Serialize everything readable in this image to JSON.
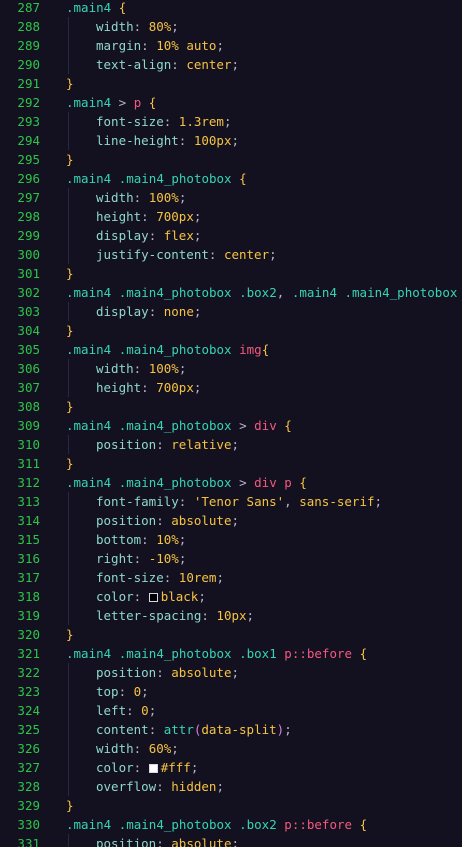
{
  "editor": {
    "colors": {
      "background": "#13111f",
      "line_number": "#2ec44a",
      "selector": "#36d3b4",
      "tag": "#f4587e",
      "brace": "#f6c343",
      "property": "#8fd8cc",
      "value": "#f6c343"
    },
    "lines": [
      {
        "n": "287",
        "indent": 0,
        "tokens": [
          {
            "t": ".main4",
            "c": "sel"
          },
          {
            "t": " ",
            "c": "plain"
          },
          {
            "t": "{",
            "c": "brace"
          }
        ]
      },
      {
        "n": "288",
        "indent": 1,
        "tokens": [
          {
            "t": "width",
            "c": "prop"
          },
          {
            "t": ": ",
            "c": "punc"
          },
          {
            "t": "80%",
            "c": "val"
          },
          {
            "t": ";",
            "c": "punc"
          }
        ]
      },
      {
        "n": "289",
        "indent": 1,
        "tokens": [
          {
            "t": "margin",
            "c": "prop"
          },
          {
            "t": ": ",
            "c": "punc"
          },
          {
            "t": "10%",
            "c": "val"
          },
          {
            "t": " ",
            "c": "plain"
          },
          {
            "t": "auto",
            "c": "val"
          },
          {
            "t": ";",
            "c": "punc"
          }
        ]
      },
      {
        "n": "290",
        "indent": 1,
        "tokens": [
          {
            "t": "text-align",
            "c": "prop"
          },
          {
            "t": ": ",
            "c": "punc"
          },
          {
            "t": "center",
            "c": "val"
          },
          {
            "t": ";",
            "c": "punc"
          }
        ]
      },
      {
        "n": "291",
        "indent": 0,
        "tokens": [
          {
            "t": "}",
            "c": "brace"
          }
        ]
      },
      {
        "n": "292",
        "indent": 0,
        "tokens": [
          {
            "t": ".main4",
            "c": "sel"
          },
          {
            "t": " > ",
            "c": "punc"
          },
          {
            "t": "p",
            "c": "tag"
          },
          {
            "t": " ",
            "c": "plain"
          },
          {
            "t": "{",
            "c": "brace"
          }
        ]
      },
      {
        "n": "293",
        "indent": 1,
        "tokens": [
          {
            "t": "font-size",
            "c": "prop"
          },
          {
            "t": ": ",
            "c": "punc"
          },
          {
            "t": "1.3rem",
            "c": "val"
          },
          {
            "t": ";",
            "c": "punc"
          }
        ]
      },
      {
        "n": "294",
        "indent": 1,
        "tokens": [
          {
            "t": "line-height",
            "c": "prop"
          },
          {
            "t": ": ",
            "c": "punc"
          },
          {
            "t": "100px",
            "c": "val"
          },
          {
            "t": ";",
            "c": "punc"
          }
        ]
      },
      {
        "n": "295",
        "indent": 0,
        "tokens": [
          {
            "t": "}",
            "c": "brace"
          }
        ]
      },
      {
        "n": "296",
        "indent": 0,
        "tokens": [
          {
            "t": ".main4",
            "c": "sel"
          },
          {
            "t": " ",
            "c": "plain"
          },
          {
            "t": ".main4_photobox",
            "c": "sel"
          },
          {
            "t": " ",
            "c": "plain"
          },
          {
            "t": "{",
            "c": "brace"
          }
        ]
      },
      {
        "n": "297",
        "indent": 1,
        "tokens": [
          {
            "t": "width",
            "c": "prop"
          },
          {
            "t": ": ",
            "c": "punc"
          },
          {
            "t": "100%",
            "c": "val"
          },
          {
            "t": ";",
            "c": "punc"
          }
        ]
      },
      {
        "n": "298",
        "indent": 1,
        "tokens": [
          {
            "t": "height",
            "c": "prop"
          },
          {
            "t": ": ",
            "c": "punc"
          },
          {
            "t": "700px",
            "c": "val"
          },
          {
            "t": ";",
            "c": "punc"
          }
        ]
      },
      {
        "n": "299",
        "indent": 1,
        "tokens": [
          {
            "t": "display",
            "c": "prop"
          },
          {
            "t": ": ",
            "c": "punc"
          },
          {
            "t": "flex",
            "c": "val"
          },
          {
            "t": ";",
            "c": "punc"
          }
        ]
      },
      {
        "n": "300",
        "indent": 1,
        "tokens": [
          {
            "t": "justify-content",
            "c": "prop"
          },
          {
            "t": ": ",
            "c": "punc"
          },
          {
            "t": "center",
            "c": "val"
          },
          {
            "t": ";",
            "c": "punc"
          }
        ]
      },
      {
        "n": "301",
        "indent": 0,
        "tokens": [
          {
            "t": "}",
            "c": "brace"
          }
        ]
      },
      {
        "n": "302",
        "indent": 0,
        "tokens": [
          {
            "t": ".main4",
            "c": "sel"
          },
          {
            "t": " ",
            "c": "plain"
          },
          {
            "t": ".main4_photobox",
            "c": "sel"
          },
          {
            "t": " ",
            "c": "plain"
          },
          {
            "t": ".box2",
            "c": "sel"
          },
          {
            "t": ", ",
            "c": "punc"
          },
          {
            "t": ".main4",
            "c": "sel"
          },
          {
            "t": " ",
            "c": "plain"
          },
          {
            "t": ".main4_photobox",
            "c": "sel"
          }
        ]
      },
      {
        "n": "303",
        "indent": 1,
        "tokens": [
          {
            "t": "display",
            "c": "prop"
          },
          {
            "t": ": ",
            "c": "punc"
          },
          {
            "t": "none",
            "c": "val"
          },
          {
            "t": ";",
            "c": "punc"
          }
        ]
      },
      {
        "n": "304",
        "indent": 0,
        "tokens": [
          {
            "t": "}",
            "c": "brace"
          }
        ]
      },
      {
        "n": "305",
        "indent": 0,
        "tokens": [
          {
            "t": ".main4",
            "c": "sel"
          },
          {
            "t": " ",
            "c": "plain"
          },
          {
            "t": ".main4_photobox",
            "c": "sel"
          },
          {
            "t": " ",
            "c": "plain"
          },
          {
            "t": "img",
            "c": "tag"
          },
          {
            "t": "{",
            "c": "brace"
          }
        ]
      },
      {
        "n": "306",
        "indent": 1,
        "tokens": [
          {
            "t": "width",
            "c": "prop"
          },
          {
            "t": ": ",
            "c": "punc"
          },
          {
            "t": "100%",
            "c": "val"
          },
          {
            "t": ";",
            "c": "punc"
          }
        ]
      },
      {
        "n": "307",
        "indent": 1,
        "tokens": [
          {
            "t": "height",
            "c": "prop"
          },
          {
            "t": ": ",
            "c": "punc"
          },
          {
            "t": "700px",
            "c": "val"
          },
          {
            "t": ";",
            "c": "punc"
          }
        ]
      },
      {
        "n": "308",
        "indent": 0,
        "tokens": [
          {
            "t": "}",
            "c": "brace"
          }
        ]
      },
      {
        "n": "309",
        "indent": 0,
        "tokens": [
          {
            "t": ".main4",
            "c": "sel"
          },
          {
            "t": " ",
            "c": "plain"
          },
          {
            "t": ".main4_photobox",
            "c": "sel"
          },
          {
            "t": " > ",
            "c": "punc"
          },
          {
            "t": "div",
            "c": "tag"
          },
          {
            "t": " ",
            "c": "plain"
          },
          {
            "t": "{",
            "c": "brace"
          }
        ]
      },
      {
        "n": "310",
        "indent": 1,
        "tokens": [
          {
            "t": "position",
            "c": "prop"
          },
          {
            "t": ": ",
            "c": "punc"
          },
          {
            "t": "relative",
            "c": "val"
          },
          {
            "t": ";",
            "c": "punc"
          }
        ]
      },
      {
        "n": "311",
        "indent": 0,
        "tokens": [
          {
            "t": "}",
            "c": "brace"
          }
        ]
      },
      {
        "n": "312",
        "indent": 0,
        "tokens": [
          {
            "t": ".main4",
            "c": "sel"
          },
          {
            "t": " ",
            "c": "plain"
          },
          {
            "t": ".main4_photobox",
            "c": "sel"
          },
          {
            "t": " > ",
            "c": "punc"
          },
          {
            "t": "div",
            "c": "tag"
          },
          {
            "t": " ",
            "c": "plain"
          },
          {
            "t": "p",
            "c": "tag"
          },
          {
            "t": " ",
            "c": "plain"
          },
          {
            "t": "{",
            "c": "brace"
          }
        ]
      },
      {
        "n": "313",
        "indent": 1,
        "tokens": [
          {
            "t": "font-family",
            "c": "prop"
          },
          {
            "t": ": ",
            "c": "punc"
          },
          {
            "t": "'Tenor Sans'",
            "c": "str"
          },
          {
            "t": ", ",
            "c": "punc"
          },
          {
            "t": "sans-serif",
            "c": "val"
          },
          {
            "t": ";",
            "c": "punc"
          }
        ]
      },
      {
        "n": "314",
        "indent": 1,
        "tokens": [
          {
            "t": "position",
            "c": "prop"
          },
          {
            "t": ": ",
            "c": "punc"
          },
          {
            "t": "absolute",
            "c": "val"
          },
          {
            "t": ";",
            "c": "punc"
          }
        ]
      },
      {
        "n": "315",
        "indent": 1,
        "tokens": [
          {
            "t": "bottom",
            "c": "prop"
          },
          {
            "t": ": ",
            "c": "punc"
          },
          {
            "t": "10%",
            "c": "val"
          },
          {
            "t": ";",
            "c": "punc"
          }
        ]
      },
      {
        "n": "316",
        "indent": 1,
        "tokens": [
          {
            "t": "right",
            "c": "prop"
          },
          {
            "t": ": ",
            "c": "punc"
          },
          {
            "t": "-10%",
            "c": "val"
          },
          {
            "t": ";",
            "c": "punc"
          }
        ]
      },
      {
        "n": "317",
        "indent": 1,
        "tokens": [
          {
            "t": "font-size",
            "c": "prop"
          },
          {
            "t": ": ",
            "c": "punc"
          },
          {
            "t": "10rem",
            "c": "val"
          },
          {
            "t": ";",
            "c": "punc"
          }
        ]
      },
      {
        "n": "318",
        "indent": 1,
        "tokens": [
          {
            "t": "color",
            "c": "prop"
          },
          {
            "t": ": ",
            "c": "punc"
          },
          {
            "t": "",
            "c": "swatch",
            "color": "#000000"
          },
          {
            "t": "black",
            "c": "val"
          },
          {
            "t": ";",
            "c": "punc"
          }
        ]
      },
      {
        "n": "319",
        "indent": 1,
        "tokens": [
          {
            "t": "letter-spacing",
            "c": "prop"
          },
          {
            "t": ": ",
            "c": "punc"
          },
          {
            "t": "10px",
            "c": "val"
          },
          {
            "t": ";",
            "c": "punc"
          }
        ]
      },
      {
        "n": "320",
        "indent": 0,
        "tokens": [
          {
            "t": "}",
            "c": "brace"
          }
        ]
      },
      {
        "n": "321",
        "indent": 0,
        "tokens": [
          {
            "t": ".main4",
            "c": "sel"
          },
          {
            "t": " ",
            "c": "plain"
          },
          {
            "t": ".main4_photobox",
            "c": "sel"
          },
          {
            "t": " ",
            "c": "plain"
          },
          {
            "t": ".box1",
            "c": "sel"
          },
          {
            "t": " ",
            "c": "plain"
          },
          {
            "t": "p",
            "c": "tag"
          },
          {
            "t": "::before",
            "c": "pse"
          },
          {
            "t": " ",
            "c": "plain"
          },
          {
            "t": "{",
            "c": "brace"
          }
        ]
      },
      {
        "n": "322",
        "indent": 1,
        "tokens": [
          {
            "t": "position",
            "c": "prop"
          },
          {
            "t": ": ",
            "c": "punc"
          },
          {
            "t": "absolute",
            "c": "val"
          },
          {
            "t": ";",
            "c": "punc"
          }
        ]
      },
      {
        "n": "323",
        "indent": 1,
        "tokens": [
          {
            "t": "top",
            "c": "prop"
          },
          {
            "t": ": ",
            "c": "punc"
          },
          {
            "t": "0",
            "c": "val"
          },
          {
            "t": ";",
            "c": "punc"
          }
        ]
      },
      {
        "n": "324",
        "indent": 1,
        "tokens": [
          {
            "t": "left",
            "c": "prop"
          },
          {
            "t": ": ",
            "c": "punc"
          },
          {
            "t": "0",
            "c": "val"
          },
          {
            "t": ";",
            "c": "punc"
          }
        ]
      },
      {
        "n": "325",
        "indent": 1,
        "tokens": [
          {
            "t": "content",
            "c": "prop"
          },
          {
            "t": ": ",
            "c": "punc"
          },
          {
            "t": "attr",
            "c": "func"
          },
          {
            "t": "(",
            "c": "paren"
          },
          {
            "t": "data-split",
            "c": "val"
          },
          {
            "t": ")",
            "c": "paren"
          },
          {
            "t": ";",
            "c": "punc"
          }
        ]
      },
      {
        "n": "326",
        "indent": 1,
        "tokens": [
          {
            "t": "width",
            "c": "prop"
          },
          {
            "t": ": ",
            "c": "punc"
          },
          {
            "t": "60%",
            "c": "val"
          },
          {
            "t": ";",
            "c": "punc"
          }
        ]
      },
      {
        "n": "327",
        "indent": 1,
        "tokens": [
          {
            "t": "color",
            "c": "prop"
          },
          {
            "t": ": ",
            "c": "punc"
          },
          {
            "t": "",
            "c": "swatch",
            "color": "#ffffff"
          },
          {
            "t": "#fff",
            "c": "val"
          },
          {
            "t": ";",
            "c": "punc"
          }
        ]
      },
      {
        "n": "328",
        "indent": 1,
        "tokens": [
          {
            "t": "overflow",
            "c": "prop"
          },
          {
            "t": ": ",
            "c": "punc"
          },
          {
            "t": "hidden",
            "c": "val"
          },
          {
            "t": ";",
            "c": "punc"
          }
        ]
      },
      {
        "n": "329",
        "indent": 0,
        "tokens": [
          {
            "t": "}",
            "c": "brace"
          }
        ]
      },
      {
        "n": "330",
        "indent": 0,
        "tokens": [
          {
            "t": ".main4",
            "c": "sel"
          },
          {
            "t": " ",
            "c": "plain"
          },
          {
            "t": ".main4_photobox",
            "c": "sel"
          },
          {
            "t": " ",
            "c": "plain"
          },
          {
            "t": ".box2",
            "c": "sel"
          },
          {
            "t": " ",
            "c": "plain"
          },
          {
            "t": "p",
            "c": "tag"
          },
          {
            "t": "::before",
            "c": "pse"
          },
          {
            "t": " ",
            "c": "plain"
          },
          {
            "t": "{",
            "c": "brace"
          }
        ]
      },
      {
        "n": "331",
        "indent": 1,
        "tokens": [
          {
            "t": "position",
            "c": "prop"
          },
          {
            "t": ": ",
            "c": "punc"
          },
          {
            "t": "absolute",
            "c": "val"
          },
          {
            "t": ";",
            "c": "punc"
          }
        ]
      }
    ]
  }
}
